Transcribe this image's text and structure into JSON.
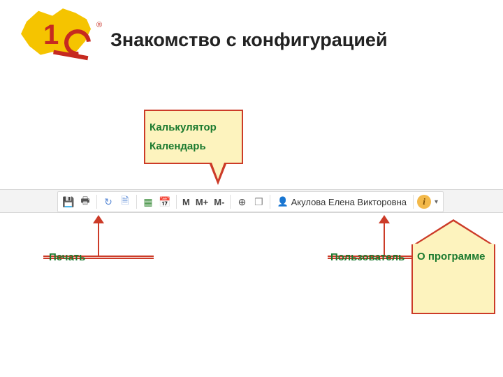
{
  "title": "Знакомство с конфигурацией",
  "logo": {
    "digit": "1",
    "reg": "®"
  },
  "callout_top": {
    "line1": "Калькулятор",
    "line2": "Календарь"
  },
  "toolbar": {
    "memory": {
      "m": "M",
      "mplus": "M+",
      "mminus": "M-"
    },
    "user_name": "Акулова Елена Викторовна",
    "info_glyph": "i",
    "caret": "▾"
  },
  "labels": {
    "print": "Печать",
    "user": "Пользователь",
    "about": "О программе"
  },
  "icons": {
    "save": "💾",
    "print": "🖶",
    "refresh": "↻",
    "doc": "🗎",
    "table": "▦",
    "calendar": "📅",
    "zoom": "⊕",
    "windows": "❐",
    "user": "👤"
  }
}
